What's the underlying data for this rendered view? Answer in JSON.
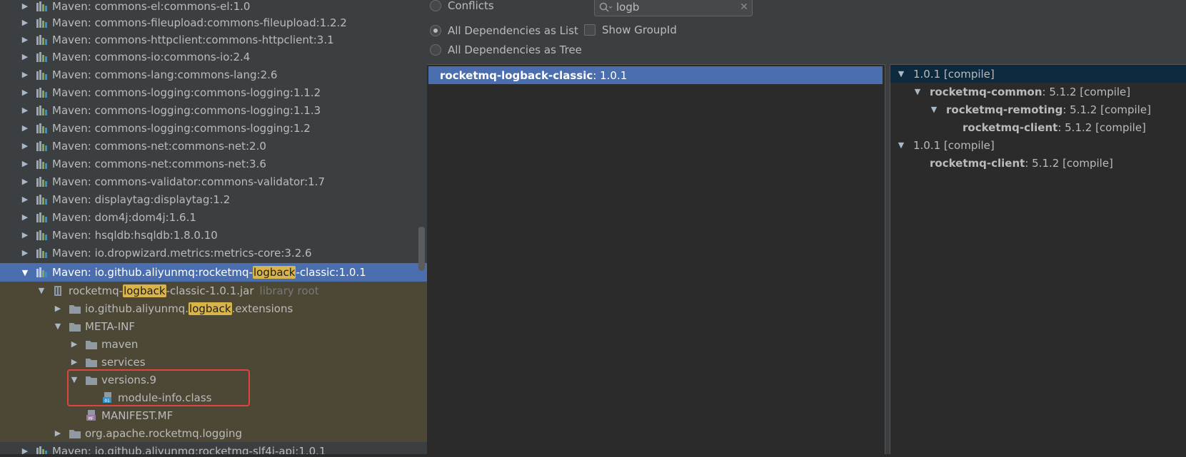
{
  "tree": {
    "rows": [
      {
        "prefix": "Maven: commons-el:commons-el:1.0"
      },
      {
        "prefix": "Maven: commons-fileupload:commons-fileupload:1.2.2"
      },
      {
        "prefix": "Maven: commons-httpclient:commons-httpclient:3.1"
      },
      {
        "prefix": "Maven: commons-io:commons-io:2.4"
      },
      {
        "prefix": "Maven: commons-lang:commons-lang:2.6"
      },
      {
        "prefix": "Maven: commons-logging:commons-logging:1.1.2"
      },
      {
        "prefix": "Maven: commons-logging:commons-logging:1.1.3"
      },
      {
        "prefix": "Maven: commons-logging:commons-logging:1.2"
      },
      {
        "prefix": "Maven: commons-net:commons-net:2.0"
      },
      {
        "prefix": "Maven: commons-net:commons-net:3.6"
      },
      {
        "prefix": "Maven: commons-validator:commons-validator:1.7"
      },
      {
        "prefix": "Maven: displaytag:displaytag:1.2"
      },
      {
        "prefix": "Maven: dom4j:dom4j:1.6.1"
      },
      {
        "prefix": "Maven: hsqldb:hsqldb:1.8.0.10"
      },
      {
        "prefix": "Maven: io.dropwizard.metrics:metrics-core:3.2.6"
      },
      {
        "prefix": "Maven: io.github.aliyunmq:rocketmq-",
        "match": "logback",
        "suffix": "-classic:1.0.1"
      },
      {
        "prefix": "rocketmq-",
        "match": "logback",
        "suffix": "-classic-1.0.1.jar",
        "extra": "library root"
      },
      {
        "prefix": "io.github.aliyunmq.",
        "match": "logback",
        "suffix": ".extensions"
      },
      {
        "prefix": "META-INF"
      },
      {
        "prefix": "maven"
      },
      {
        "prefix": "services"
      },
      {
        "prefix": "versions.9"
      },
      {
        "prefix": "module-info.class"
      },
      {
        "prefix": "MANIFEST.MF"
      },
      {
        "prefix": "org.apache.rocketmq.logging"
      },
      {
        "prefix": "Maven: io.github.aliyunmq:rocketmq-slf4j-api:1.0.1"
      }
    ]
  },
  "analyzer": {
    "conflicts_label": "Conflicts",
    "search_value": "logb",
    "list_label": "All Dependencies as List",
    "tree_label": "All Dependencies as Tree",
    "show_groupid_label": "Show GroupId",
    "selected_mode": "list",
    "list_item": {
      "name": "rocketmq-logback-classic",
      "version": " : 1.0.1"
    },
    "dep_tree": [
      {
        "name": "",
        "rest": "1.0.1 [compile]"
      },
      {
        "name": "rocketmq-common",
        "rest": " : 5.1.2 [compile]"
      },
      {
        "name": "rocketmq-remoting",
        "rest": " : 5.1.2 [compile]"
      },
      {
        "name": "rocketmq-client",
        "rest": " : 5.1.2 [compile]"
      },
      {
        "name": "",
        "rest": "1.0.1 [compile]"
      },
      {
        "name": "rocketmq-client",
        "rest": " : 5.1.2 [compile]"
      }
    ]
  },
  "colors": {
    "selection": "#4b6eaf",
    "highlight": "#d8b44a",
    "annotation_box": "#e0443e",
    "library_row_bg": "#4d4735"
  }
}
